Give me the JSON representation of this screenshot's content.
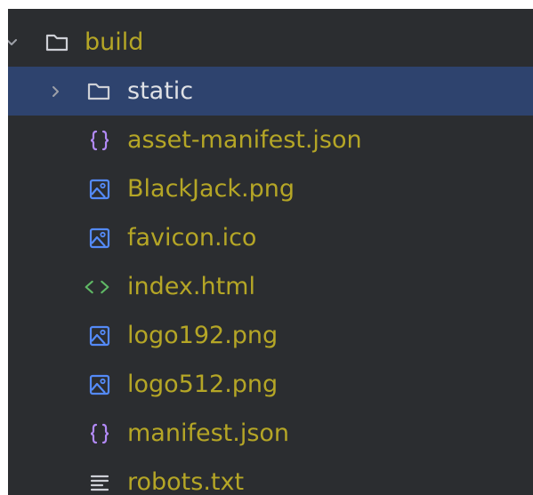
{
  "tree": {
    "root": {
      "label": "build",
      "expanded": true,
      "chevron_icon": "chevron-down-icon",
      "icon": "folder-icon"
    },
    "items": [
      {
        "label": "static",
        "type": "folder",
        "icon": "folder-icon",
        "chevron_icon": "chevron-right-icon",
        "selected": true
      },
      {
        "label": "asset-manifest.json",
        "type": "json",
        "icon": "json-braces-icon"
      },
      {
        "label": "BlackJack.png",
        "type": "image",
        "icon": "image-file-icon"
      },
      {
        "label": "favicon.ico",
        "type": "image",
        "icon": "image-file-icon"
      },
      {
        "label": "index.html",
        "type": "html",
        "icon": "html-tag-icon"
      },
      {
        "label": "logo192.png",
        "type": "image",
        "icon": "image-file-icon"
      },
      {
        "label": "logo512.png",
        "type": "image",
        "icon": "image-file-icon"
      },
      {
        "label": "manifest.json",
        "type": "json",
        "icon": "json-braces-icon"
      },
      {
        "label": "robots.txt",
        "type": "text",
        "icon": "text-file-icon"
      }
    ]
  },
  "colors": {
    "background": "#2b2d30",
    "selection": "#2e436e",
    "file_label": "#b5a626",
    "selected_label": "#dfe1e5",
    "image_icon": "#548af7",
    "json_icon": "#b189f5",
    "html_icon": "#5fb865",
    "folder_icon": "#ced0d6"
  }
}
